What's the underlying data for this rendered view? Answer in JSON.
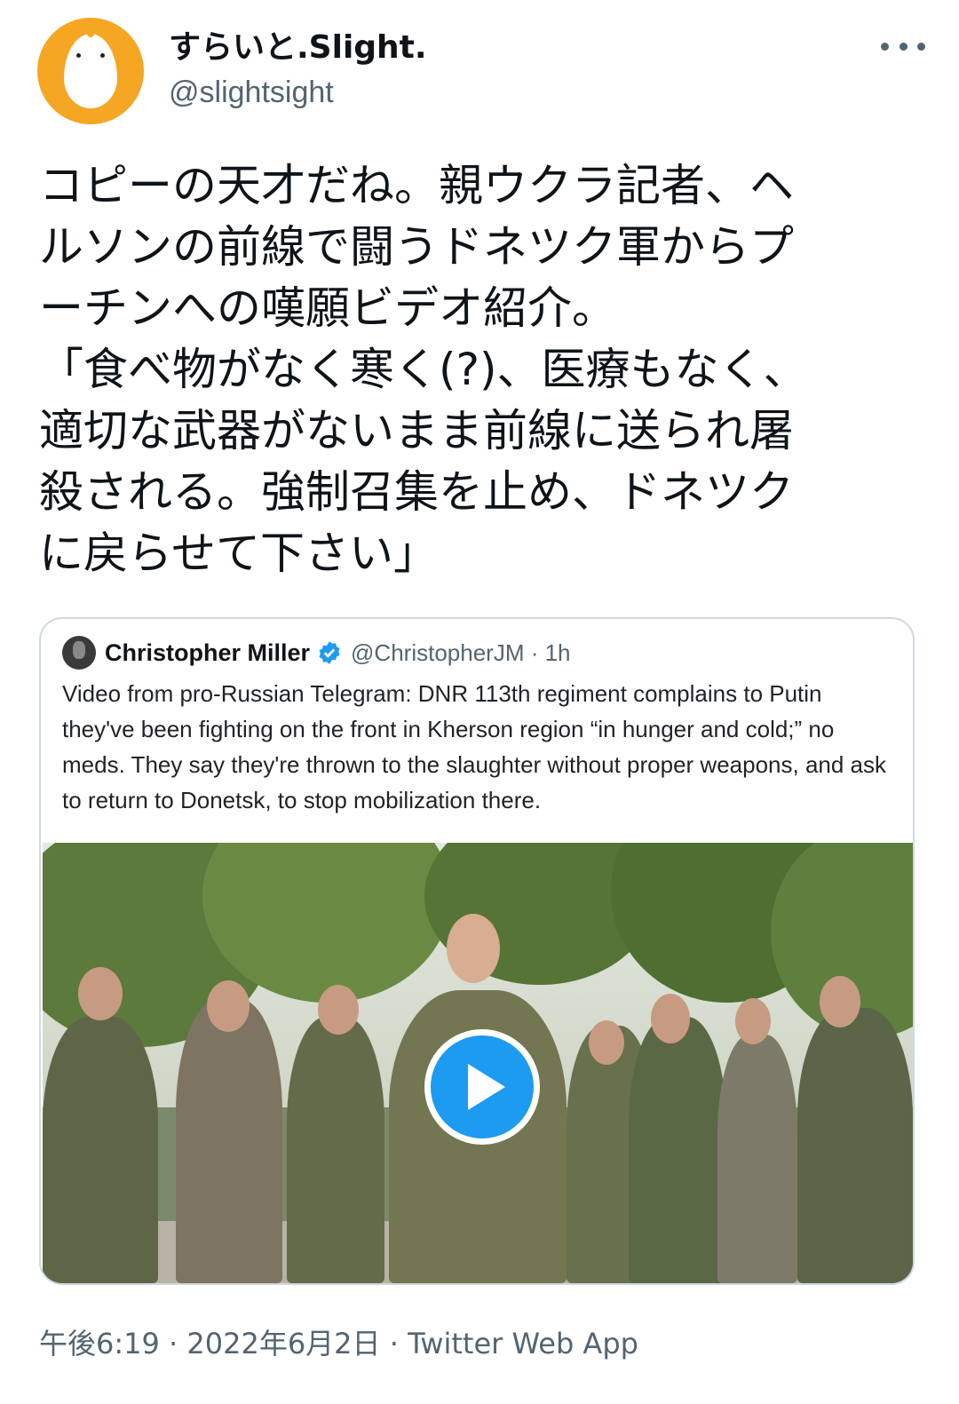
{
  "tweet": {
    "display_name": "すらいと.Slight.",
    "handle": "@slightsight",
    "text": "コピーの天才だね。親ウクラ記者、ヘ\nルソンの前線で闘うドネツク軍からプ\nーチンへの嘆願ビデオ紹介。\n「食べ物がなく寒く(?)、医療もなく、\n適切な武器がないまま前線に送られ屠\n殺される。強制召集を止め、ドネツク\nに戻らせて下さい」",
    "timestamp": "午後6:19 · 2022年6月2日",
    "separator": " · ",
    "source": "Twitter Web App"
  },
  "quoted": {
    "name": "Christopher Miller",
    "meta": "@ChristopherJM · 1h",
    "text": "Video from pro-Russian Telegram: DNR 113th regiment complains to Putin they've been fighting on the front in Kherson region “in hunger and cold;” no meds. They say they're thrown to the slaughter without proper weapons, and ask to return to Donetsk, to stop mobilization there."
  },
  "colors": {
    "avatar_bg": "#f5a623",
    "verified": "#1d9bf0",
    "secondary_text": "#536471"
  },
  "icons": [
    "more-icon",
    "verified-icon",
    "play-icon"
  ]
}
